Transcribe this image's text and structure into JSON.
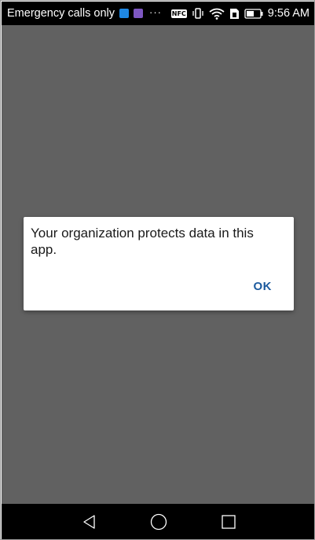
{
  "status_bar": {
    "carrier_text": "Emergency calls only",
    "more_indicator": "···",
    "nfc_label": "NFC",
    "time": "9:56 AM",
    "icons": [
      "app-notification-blue-icon",
      "app-notification-purple-icon",
      "nfc-icon",
      "vibrate-icon",
      "wifi-icon",
      "sim-icon",
      "battery-icon"
    ],
    "colors": {
      "notification_blue": "#1e88e5",
      "notification_purple": "#7e57c2"
    }
  },
  "dialog": {
    "message": "Your organization protects data in this app.",
    "ok_label": "OK",
    "ok_color": "#1c5a9e"
  },
  "screen": {
    "background": "#616161"
  },
  "nav_bar": {
    "icons": [
      "back-icon",
      "home-icon",
      "recents-icon"
    ]
  }
}
